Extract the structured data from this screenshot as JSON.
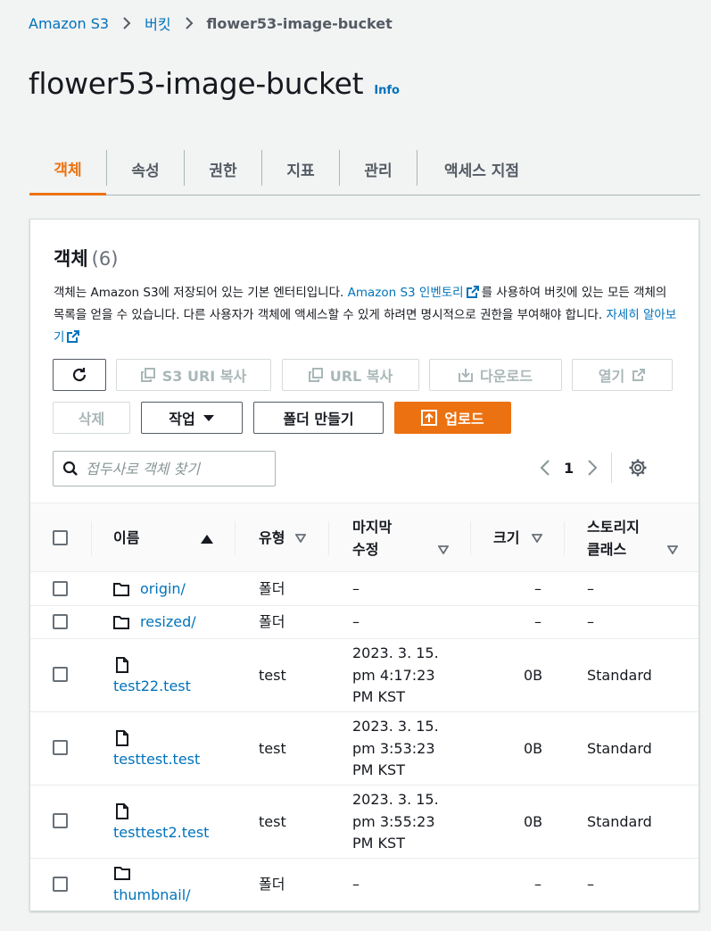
{
  "breadcrumb": {
    "root": "Amazon S3",
    "section": "버킷",
    "current": "flower53-image-bucket"
  },
  "page": {
    "title": "flower53-image-bucket",
    "info": "Info"
  },
  "tabs": [
    {
      "label": "객체",
      "active": true
    },
    {
      "label": "속성"
    },
    {
      "label": "권한"
    },
    {
      "label": "지표"
    },
    {
      "label": "관리"
    },
    {
      "label": "액세스 지점"
    }
  ],
  "objects_panel": {
    "title": "객체",
    "count": "(6)",
    "desc_part1": "객체는 Amazon S3에 저장되어 있는 기본 엔터티입니다. ",
    "desc_link1": "Amazon S3 인벤토리",
    "desc_part2": "를 사용하여 버킷에 있는 모든 객체의 목록을 얻을 수 있습니다. 다른 사용자가 객체에 액세스할 수 있게 하려면 명시적으로 권한을 부여해야 합니다. ",
    "desc_link2": "자세히 알아보기"
  },
  "toolbar": {
    "copy_s3_uri": "S3 URI 복사",
    "copy_url": "URL 복사",
    "download": "다운로드",
    "open": "열기",
    "delete": "삭제",
    "actions": "작업",
    "create_folder": "폴더 만들기",
    "upload": "업로드"
  },
  "search": {
    "placeholder": "접두사로 객체 찾기"
  },
  "pagination": {
    "current_page": "1"
  },
  "table": {
    "headers": {
      "name": "이름",
      "type": "유형",
      "modified_line1": "마지막",
      "modified_line2": "수정",
      "size": "크기",
      "storage_line1": "스토리지",
      "storage_line2": "클래스"
    },
    "rows": [
      {
        "name": "origin/",
        "kind": "folder",
        "type": "폴더",
        "modified_1": "–",
        "modified_2": "",
        "modified_3": "",
        "size": "–",
        "storage": "–"
      },
      {
        "name": "resized/",
        "kind": "folder",
        "type": "폴더",
        "modified_1": "–",
        "modified_2": "",
        "modified_3": "",
        "size": "–",
        "storage": "–"
      },
      {
        "name": "test22.test",
        "kind": "file",
        "type": "test",
        "modified_1": "2023. 3. 15.",
        "modified_2": "pm 4:17:23",
        "modified_3": "PM KST",
        "size": "0B",
        "storage": "Standard"
      },
      {
        "name": "testtest.test",
        "kind": "file",
        "type": "test",
        "modified_1": "2023. 3. 15.",
        "modified_2": "pm 3:53:23",
        "modified_3": "PM KST",
        "size": "0B",
        "storage": "Standard"
      },
      {
        "name": "testtest2.test",
        "kind": "file",
        "type": "test",
        "modified_1": "2023. 3. 15.",
        "modified_2": "pm 3:55:23",
        "modified_3": "PM KST",
        "size": "0B",
        "storage": "Standard"
      },
      {
        "name": "thumbnail/",
        "kind": "folder",
        "type": "폴더",
        "modified_1": "–",
        "modified_2": "",
        "modified_3": "",
        "size": "–",
        "storage": "–"
      }
    ]
  },
  "colors": {
    "accent": "#ec7211",
    "link": "#0073bb",
    "text": "#16191f",
    "muted": "#545b64",
    "disabled": "#aab7b8",
    "page_bg": "#f2f3f3"
  }
}
